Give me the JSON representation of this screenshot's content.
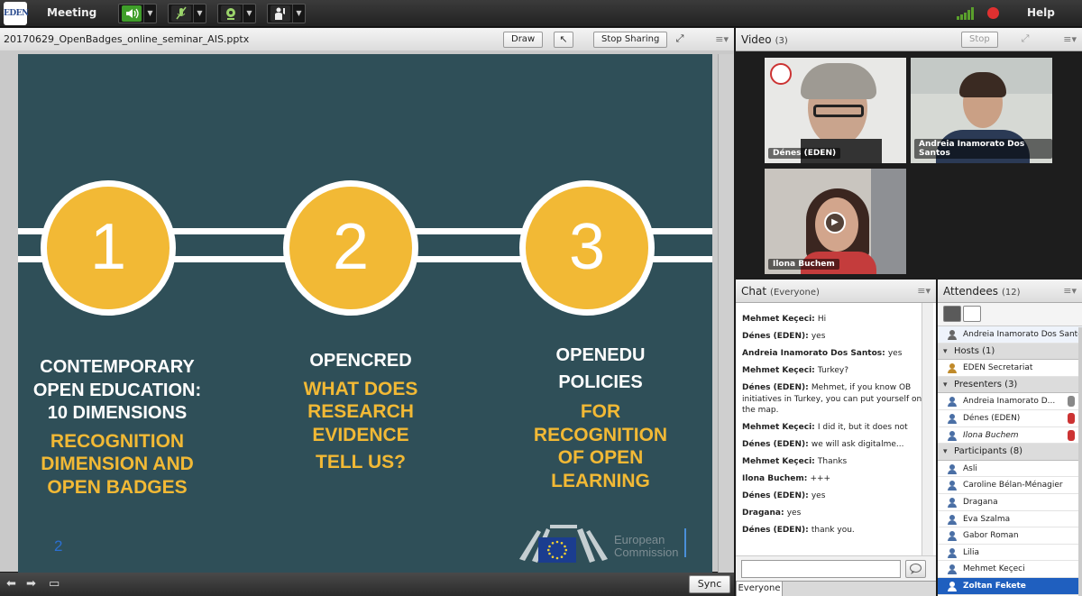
{
  "app": {
    "logo_text": "EDEN",
    "menu_meeting": "Meeting",
    "help": "Help"
  },
  "share": {
    "filename": "20170629_OpenBadges_online_seminar_AIS.pptx",
    "draw_label": "Draw",
    "stop_sharing_label": "Stop Sharing",
    "sync_label": "Sync"
  },
  "slide": {
    "circles": [
      "1",
      "2",
      "3"
    ],
    "col1": {
      "white": [
        "CONTEMPORARY",
        "OPEN EDUCATION:",
        "10 DIMENSIONS"
      ],
      "yellow": [
        "RECOGNITION",
        "DIMENSION AND",
        "OPEN BADGES"
      ]
    },
    "col2": {
      "white": [
        "OPENCRED"
      ],
      "yellow": [
        "WHAT DOES",
        "RESEARCH",
        "EVIDENCE",
        "TELL US?"
      ]
    },
    "col3": {
      "white": [
        "OPENEDU",
        "POLICIES"
      ],
      "yellow": [
        "FOR",
        "RECOGNITION",
        "OF OPEN",
        "LEARNING"
      ]
    },
    "page_number": "2",
    "logo_line1": "European",
    "logo_line2": "Commission"
  },
  "video": {
    "title": "Video",
    "count": "(3)",
    "stop_label": "Stop",
    "tiles": [
      {
        "name": "Dénes (EDEN)"
      },
      {
        "name": "Andreia Inamorato Dos Santos"
      },
      {
        "name": "Ilona Buchem"
      }
    ]
  },
  "chat": {
    "title": "Chat",
    "scope": "(Everyone)",
    "tab_label": "Everyone",
    "messages": [
      {
        "author": "Mehmet Keçeci",
        "text": "Hi"
      },
      {
        "author": "Dénes (EDEN)",
        "text": "yes"
      },
      {
        "author": "Andreia Inamorato Dos Santos",
        "text": "yes"
      },
      {
        "author": "Mehmet Keçeci",
        "text": "Turkey?"
      },
      {
        "author": "Dénes (EDEN)",
        "text": "Mehmet, if you know OB initiatives in Turkey, you can put yourself on the map."
      },
      {
        "author": "Mehmet Keçeci",
        "text": "I did it, but it does not"
      },
      {
        "author": "Dénes (EDEN)",
        "text": "we will ask digitalme..."
      },
      {
        "author": "Mehmet Keçeci",
        "text": "Thanks"
      },
      {
        "author": "Ilona Buchem",
        "text": "+++"
      },
      {
        "author": "Dénes (EDEN)",
        "text": "yes"
      },
      {
        "author": "Dragana",
        "text": "yes"
      },
      {
        "author": "Dénes (EDEN)",
        "text": "thank you."
      }
    ]
  },
  "attendees": {
    "title": "Attendees",
    "count": "(12)",
    "me": "Andreia Inamorato Dos Santos",
    "hosts_label": "Hosts (1)",
    "hosts": [
      "EDEN Secretariat"
    ],
    "presenters_label": "Presenters (3)",
    "presenters": [
      "Andreia Inamorato D...",
      "Dénes (EDEN)",
      "Ilona Buchem"
    ],
    "participants_label": "Participants (8)",
    "participants": [
      "Asli",
      "Caroline Bélan-Ménagier",
      "Dragana",
      "Eva Szalma",
      "Gabor Roman",
      "Lilia",
      "Mehmet Keçeci",
      "Zoltan Fekete"
    ]
  }
}
